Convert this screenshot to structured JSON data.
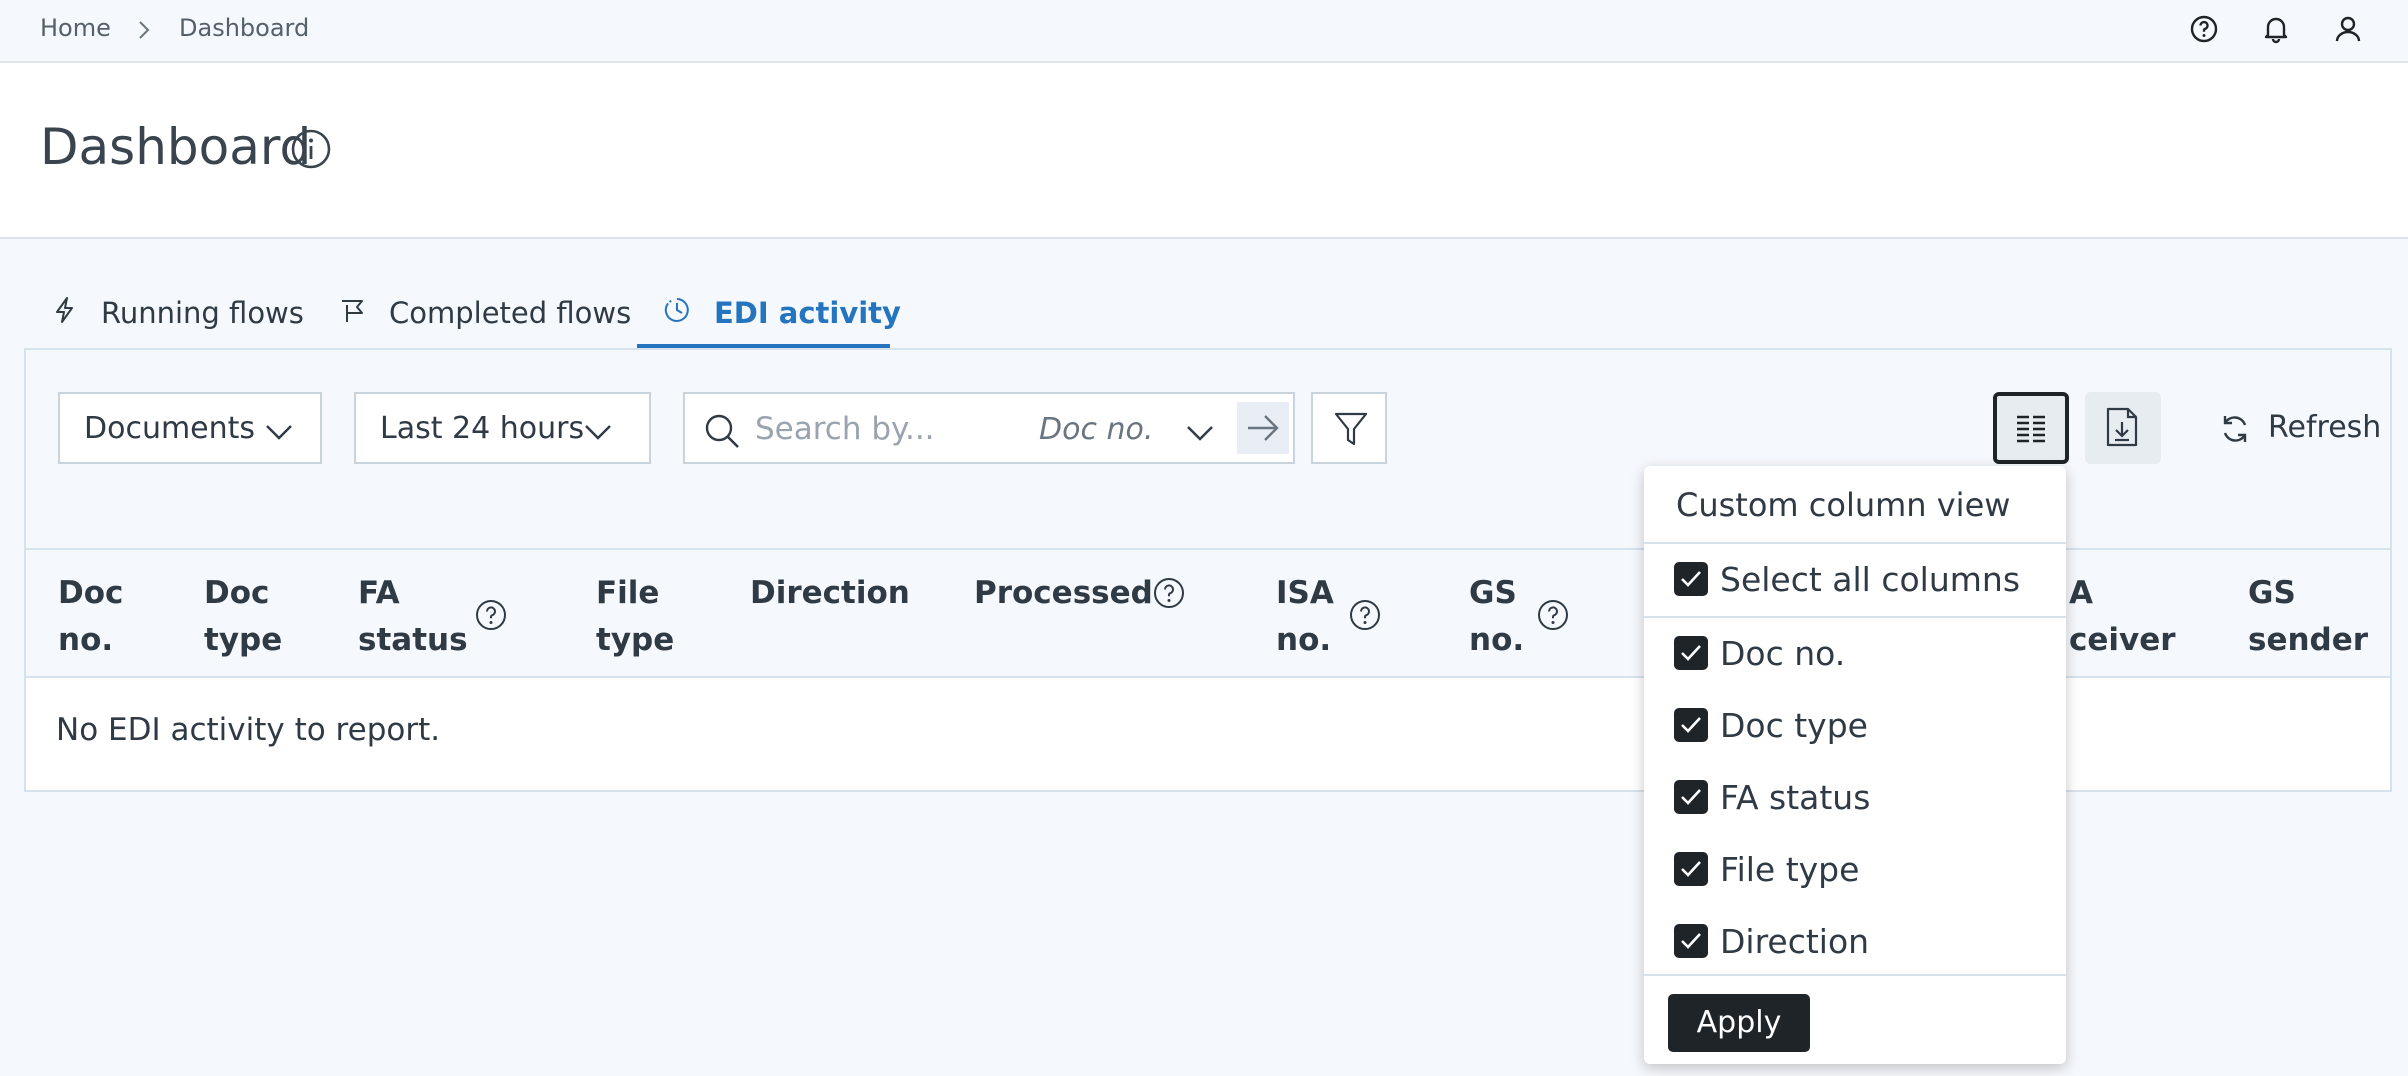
{
  "breadcrumb": {
    "home": "Home",
    "current": "Dashboard"
  },
  "header_icons": [
    "help-icon",
    "bell-icon",
    "user-icon"
  ],
  "page": {
    "title": "Dashboard"
  },
  "tabs": [
    {
      "label": "Running flows",
      "icon": "lightning-icon",
      "active": false
    },
    {
      "label": "Completed flows",
      "icon": "flag-icon",
      "active": false
    },
    {
      "label": "EDI activity",
      "icon": "pie-clock-icon",
      "active": true
    }
  ],
  "toolbar": {
    "type_select": "Documents",
    "time_select": "Last 24 hours",
    "search_placeholder": "Search by...",
    "search_value": "",
    "search_scope": "Doc no.",
    "refresh_label": "Refresh"
  },
  "table": {
    "columns": [
      {
        "line1": "Doc",
        "line2": "no.",
        "help": false
      },
      {
        "line1": "Doc",
        "line2": "type",
        "help": false
      },
      {
        "line1": "FA",
        "line2": "status",
        "help": true
      },
      {
        "line1": "File",
        "line2": "type",
        "help": false
      },
      {
        "line1": "Direction",
        "line2": "",
        "help": false
      },
      {
        "line1": "Processed",
        "line2": "",
        "help": true
      },
      {
        "line1": "ISA",
        "line2": "no.",
        "help": true
      },
      {
        "line1": "GS",
        "line2": "no.",
        "help": true
      },
      {
        "line1": "A",
        "line2": "ceiver",
        "help": false
      },
      {
        "line1": "GS",
        "line2": "sender",
        "help": false
      }
    ],
    "empty_message": "No EDI activity to report."
  },
  "column_view": {
    "title": "Custom column view",
    "select_all": {
      "label": "Select all columns",
      "checked": true
    },
    "options": [
      {
        "label": "Doc no.",
        "checked": true
      },
      {
        "label": "Doc type",
        "checked": true
      },
      {
        "label": "FA status",
        "checked": true
      },
      {
        "label": "File type",
        "checked": true
      },
      {
        "label": "Direction",
        "checked": true
      }
    ],
    "apply_label": "Apply"
  },
  "colors": {
    "accent": "#2474c0",
    "dark": "#1f2429",
    "border": "#c9d3dc",
    "background": "#f5f8fc"
  }
}
